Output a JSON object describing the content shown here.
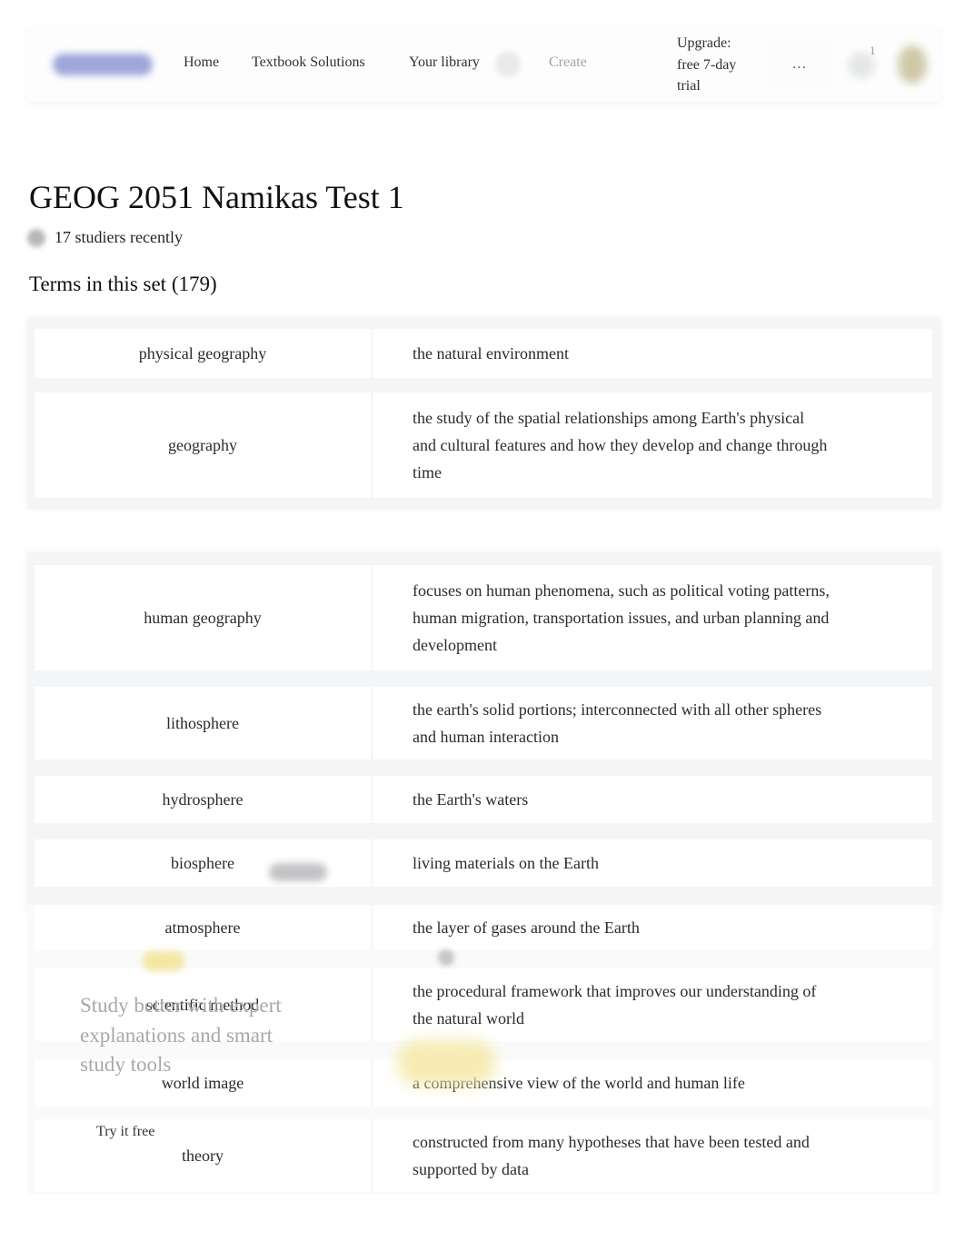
{
  "header": {
    "nav": {
      "home": "Home",
      "textbook_solutions": "Textbook Solutions",
      "your_library": "Your library",
      "create": "Create"
    },
    "upgrade_label": "Upgrade: free 7-day trial",
    "more_label": "…",
    "notification_count": "1"
  },
  "set": {
    "title": "GEOG 2051 Namikas Test 1",
    "studiers": "17 studiers recently",
    "terms_heading": "Terms in this set (179)"
  },
  "terms": [
    {
      "term": "physical geography",
      "definition": "the natural environment"
    },
    {
      "term": "geography",
      "definition": "the study of the spatial relationships among Earth's physical and cultural features and how they develop and change through time"
    },
    {
      "term": "human geography",
      "definition": "focuses on human phenomena, such as political voting patterns, human migration, transportation issues, and urban planning and development"
    },
    {
      "term": "lithosphere",
      "definition": "the earth's solid portions; interconnected with all other spheres and human interaction"
    },
    {
      "term": "hydrosphere",
      "definition": "the Earth's waters"
    },
    {
      "term": "biosphere",
      "definition": "living materials on the Earth"
    },
    {
      "term": "atmosphere",
      "definition": "the layer of gases around the Earth"
    },
    {
      "term": "scientific method",
      "definition": "the procedural framework that improves our understanding of the natural world"
    },
    {
      "term": "world image",
      "definition": "a comprehensive view of the world and human life"
    },
    {
      "term": "theory",
      "definition": "constructed from many hypotheses that have been tested and supported by data"
    }
  ],
  "promo": {
    "text": "Study better with expert explanations and smart study tools",
    "cta": "Try it free"
  }
}
